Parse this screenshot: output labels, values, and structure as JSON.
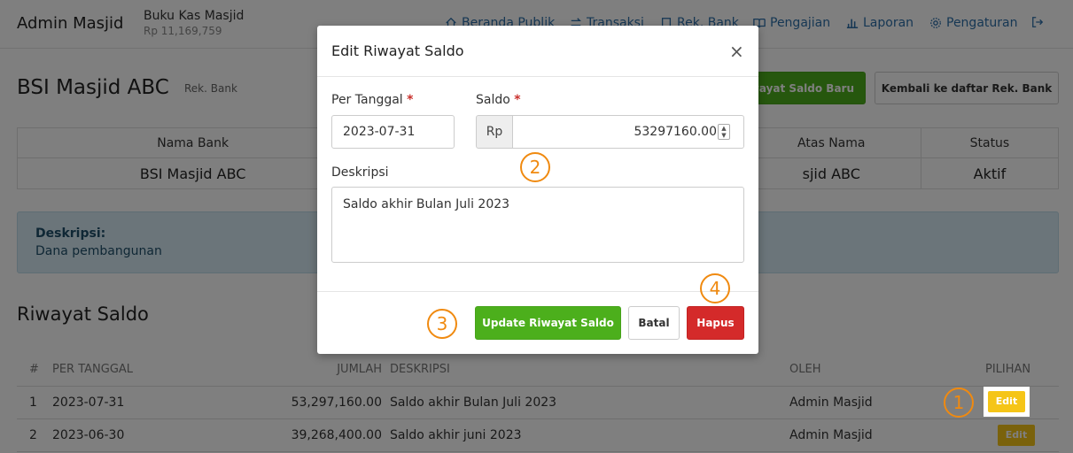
{
  "navbar": {
    "brand": "Admin Masjid",
    "book_title": "Buku Kas Masjid",
    "book_balance": "Rp 11,169,759",
    "items": [
      {
        "label": "Beranda Publik",
        "icon": "home-icon"
      },
      {
        "label": "Transaksi",
        "icon": "transfer-icon"
      },
      {
        "label": "Rek. Bank",
        "icon": "bank-icon"
      },
      {
        "label": "Pengajian",
        "icon": "book-icon"
      },
      {
        "label": "Laporan",
        "icon": "chart-icon"
      },
      {
        "label": "Pengaturan",
        "icon": "gear-icon"
      }
    ],
    "logout_icon": "logout-icon"
  },
  "page": {
    "title": "BSI Masjid ABC",
    "subtitle": "Rek. Bank",
    "new_button": "wayat Saldo Baru",
    "back_button": "Kembali ke daftar Rek. Bank"
  },
  "bank_table": {
    "headers": [
      "Nama Bank",
      "",
      "Atas Nama",
      "Status"
    ],
    "row": [
      "BSI Masjid ABC",
      "",
      "sjid ABC",
      "Aktif"
    ]
  },
  "description": {
    "label": "Deskripsi:",
    "text": "Dana pembangunan"
  },
  "history": {
    "title": "Riwayat Saldo",
    "headers": [
      "#",
      "PER TANGGAL",
      "JUMLAH",
      "DESKRIPSI",
      "OLEH",
      "PILIHAN"
    ],
    "rows": [
      {
        "no": "1",
        "date": "2023-07-31",
        "amount": "53,297,160.00",
        "desc": "Saldo akhir Bulan Juli 2023",
        "by": "Admin Masjid",
        "action": "Edit"
      },
      {
        "no": "2",
        "date": "2023-06-30",
        "amount": "39,268,400.00",
        "desc": "Saldo akhir juni 2023",
        "by": "Admin Masjid",
        "action": "Edit"
      }
    ]
  },
  "modal": {
    "title": "Edit Riwayat Saldo",
    "close": "×",
    "date_label": "Per Tanggal",
    "saldo_label": "Saldo",
    "required_mark": "*",
    "date_value": "2023-07-31",
    "currency": "Rp",
    "saldo_value": "53297160.00",
    "desc_label": "Deskripsi",
    "desc_value": "Saldo akhir Bulan Juli 2023",
    "update_button": "Update Riwayat Saldo",
    "cancel_button": "Batal",
    "delete_button": "Hapus"
  },
  "markers": [
    "1",
    "2",
    "3",
    "4"
  ],
  "colors": {
    "accent_green": "#4caf1c",
    "danger_red": "#d42a2a",
    "warning_yellow": "#f5c518",
    "marker_orange": "#f08a10",
    "link_blue": "#2d6fa8"
  }
}
